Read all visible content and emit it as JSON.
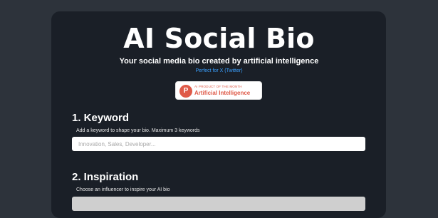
{
  "header": {
    "title": "AI Social Bio",
    "subtitle": "Your social media bio created by artificial intelligence",
    "subtitle_note": "Perfect for X (Twitter)"
  },
  "badge": {
    "logo_letter": "P",
    "top_text": "AI PRODUCT OF THE MONTH",
    "main_text": "Artificial Intelligence",
    "color": "#df5a48"
  },
  "keyword_section": {
    "title": "1. Keyword",
    "description": "Add a keyword to shape your bio. Maximum 3 keywords",
    "placeholder": "Innovation, Sales, Developer..."
  },
  "inspiration_section": {
    "title": "2. Inspiration",
    "description": "Choose an influencer to inspire your AI bio"
  },
  "colors": {
    "page_bg": "#2d333b",
    "card_bg": "#1a1f27",
    "accent": "#3aa0ff"
  }
}
